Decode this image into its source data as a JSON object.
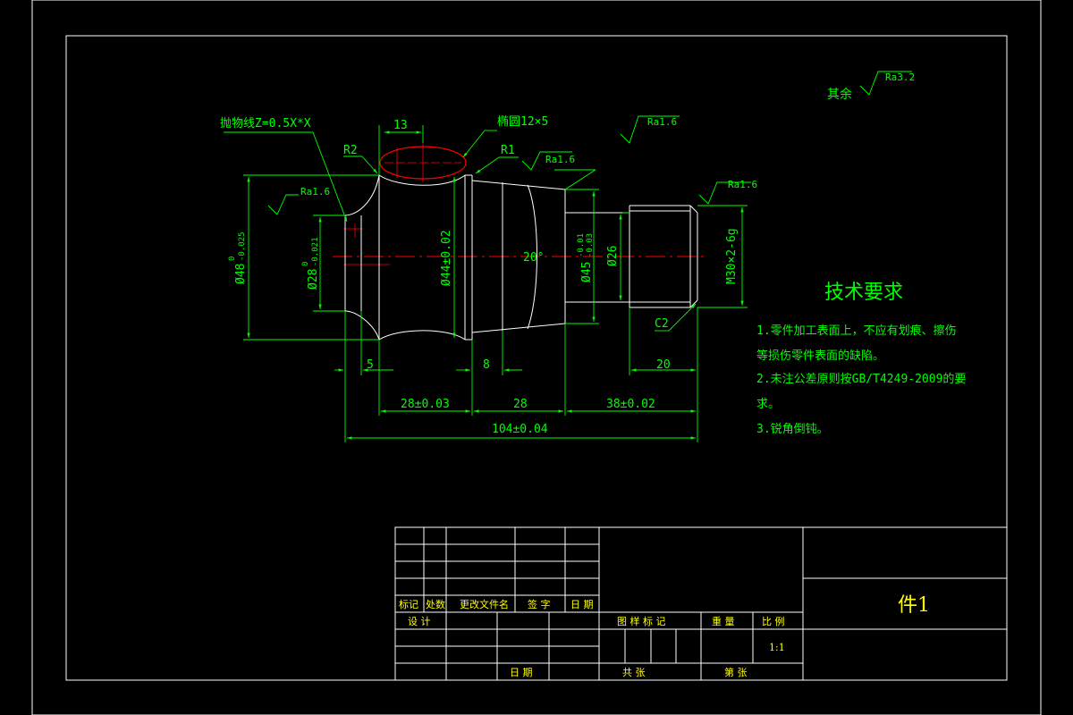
{
  "drawing": {
    "labels": {
      "parabola": "抛物线Z=0.5X*X",
      "ellipse": "椭圆12×5",
      "r2": "R2",
      "r1": "R1",
      "c2": "C2",
      "angle": "20°"
    },
    "roughness": {
      "rest_prefix": "其余",
      "rest_value": "Ra3.2",
      "ra_left": "Ra1.6",
      "ra_top": "Ra1.6",
      "ra_taper": "Ra1.6",
      "ra_right": "Ra1.6"
    },
    "dimensions": {
      "d13": "13",
      "d48_main": "Ø48",
      "d48_tol_up": "0",
      "d48_tol_low": "-0.025",
      "d28_main": "Ø28",
      "d28_tol_up": "0",
      "d28_tol_low": "-0.021",
      "d44": "Ø44±0.02",
      "d45_main": "Ø45",
      "d45_tol_up": "-0.01",
      "d45_tol_low": "-0.03",
      "d26": "Ø26",
      "m30": "M30×2-6g",
      "l5": "5",
      "l8": "8",
      "l20": "20",
      "l28a": "28±0.03",
      "l28b": "28",
      "l38": "38±0.02",
      "l104": "104±0.04"
    },
    "tech": {
      "title": "技术要求",
      "lines": [
        "1.零件加工表面上，不应有划痕、擦伤",
        "等损伤零件表面的缺陷。",
        "2.未注公差原则按GB/T4249-2009的要",
        "求。",
        "3.锐角倒钝。"
      ]
    },
    "title_block": {
      "part_name": "件1",
      "h_mark": "标记",
      "h_count": "处数",
      "h_doc": "更改文件名",
      "h_sign": "签  字",
      "h_date": "日  期",
      "h_design": "设  计",
      "h_date2": "日  期",
      "h_stage": "图  样  标  记",
      "h_weight": "重  量",
      "h_scale": "比  例",
      "scale_value": "1:1",
      "h_total": "共        张",
      "h_sheet": "第        张"
    }
  }
}
